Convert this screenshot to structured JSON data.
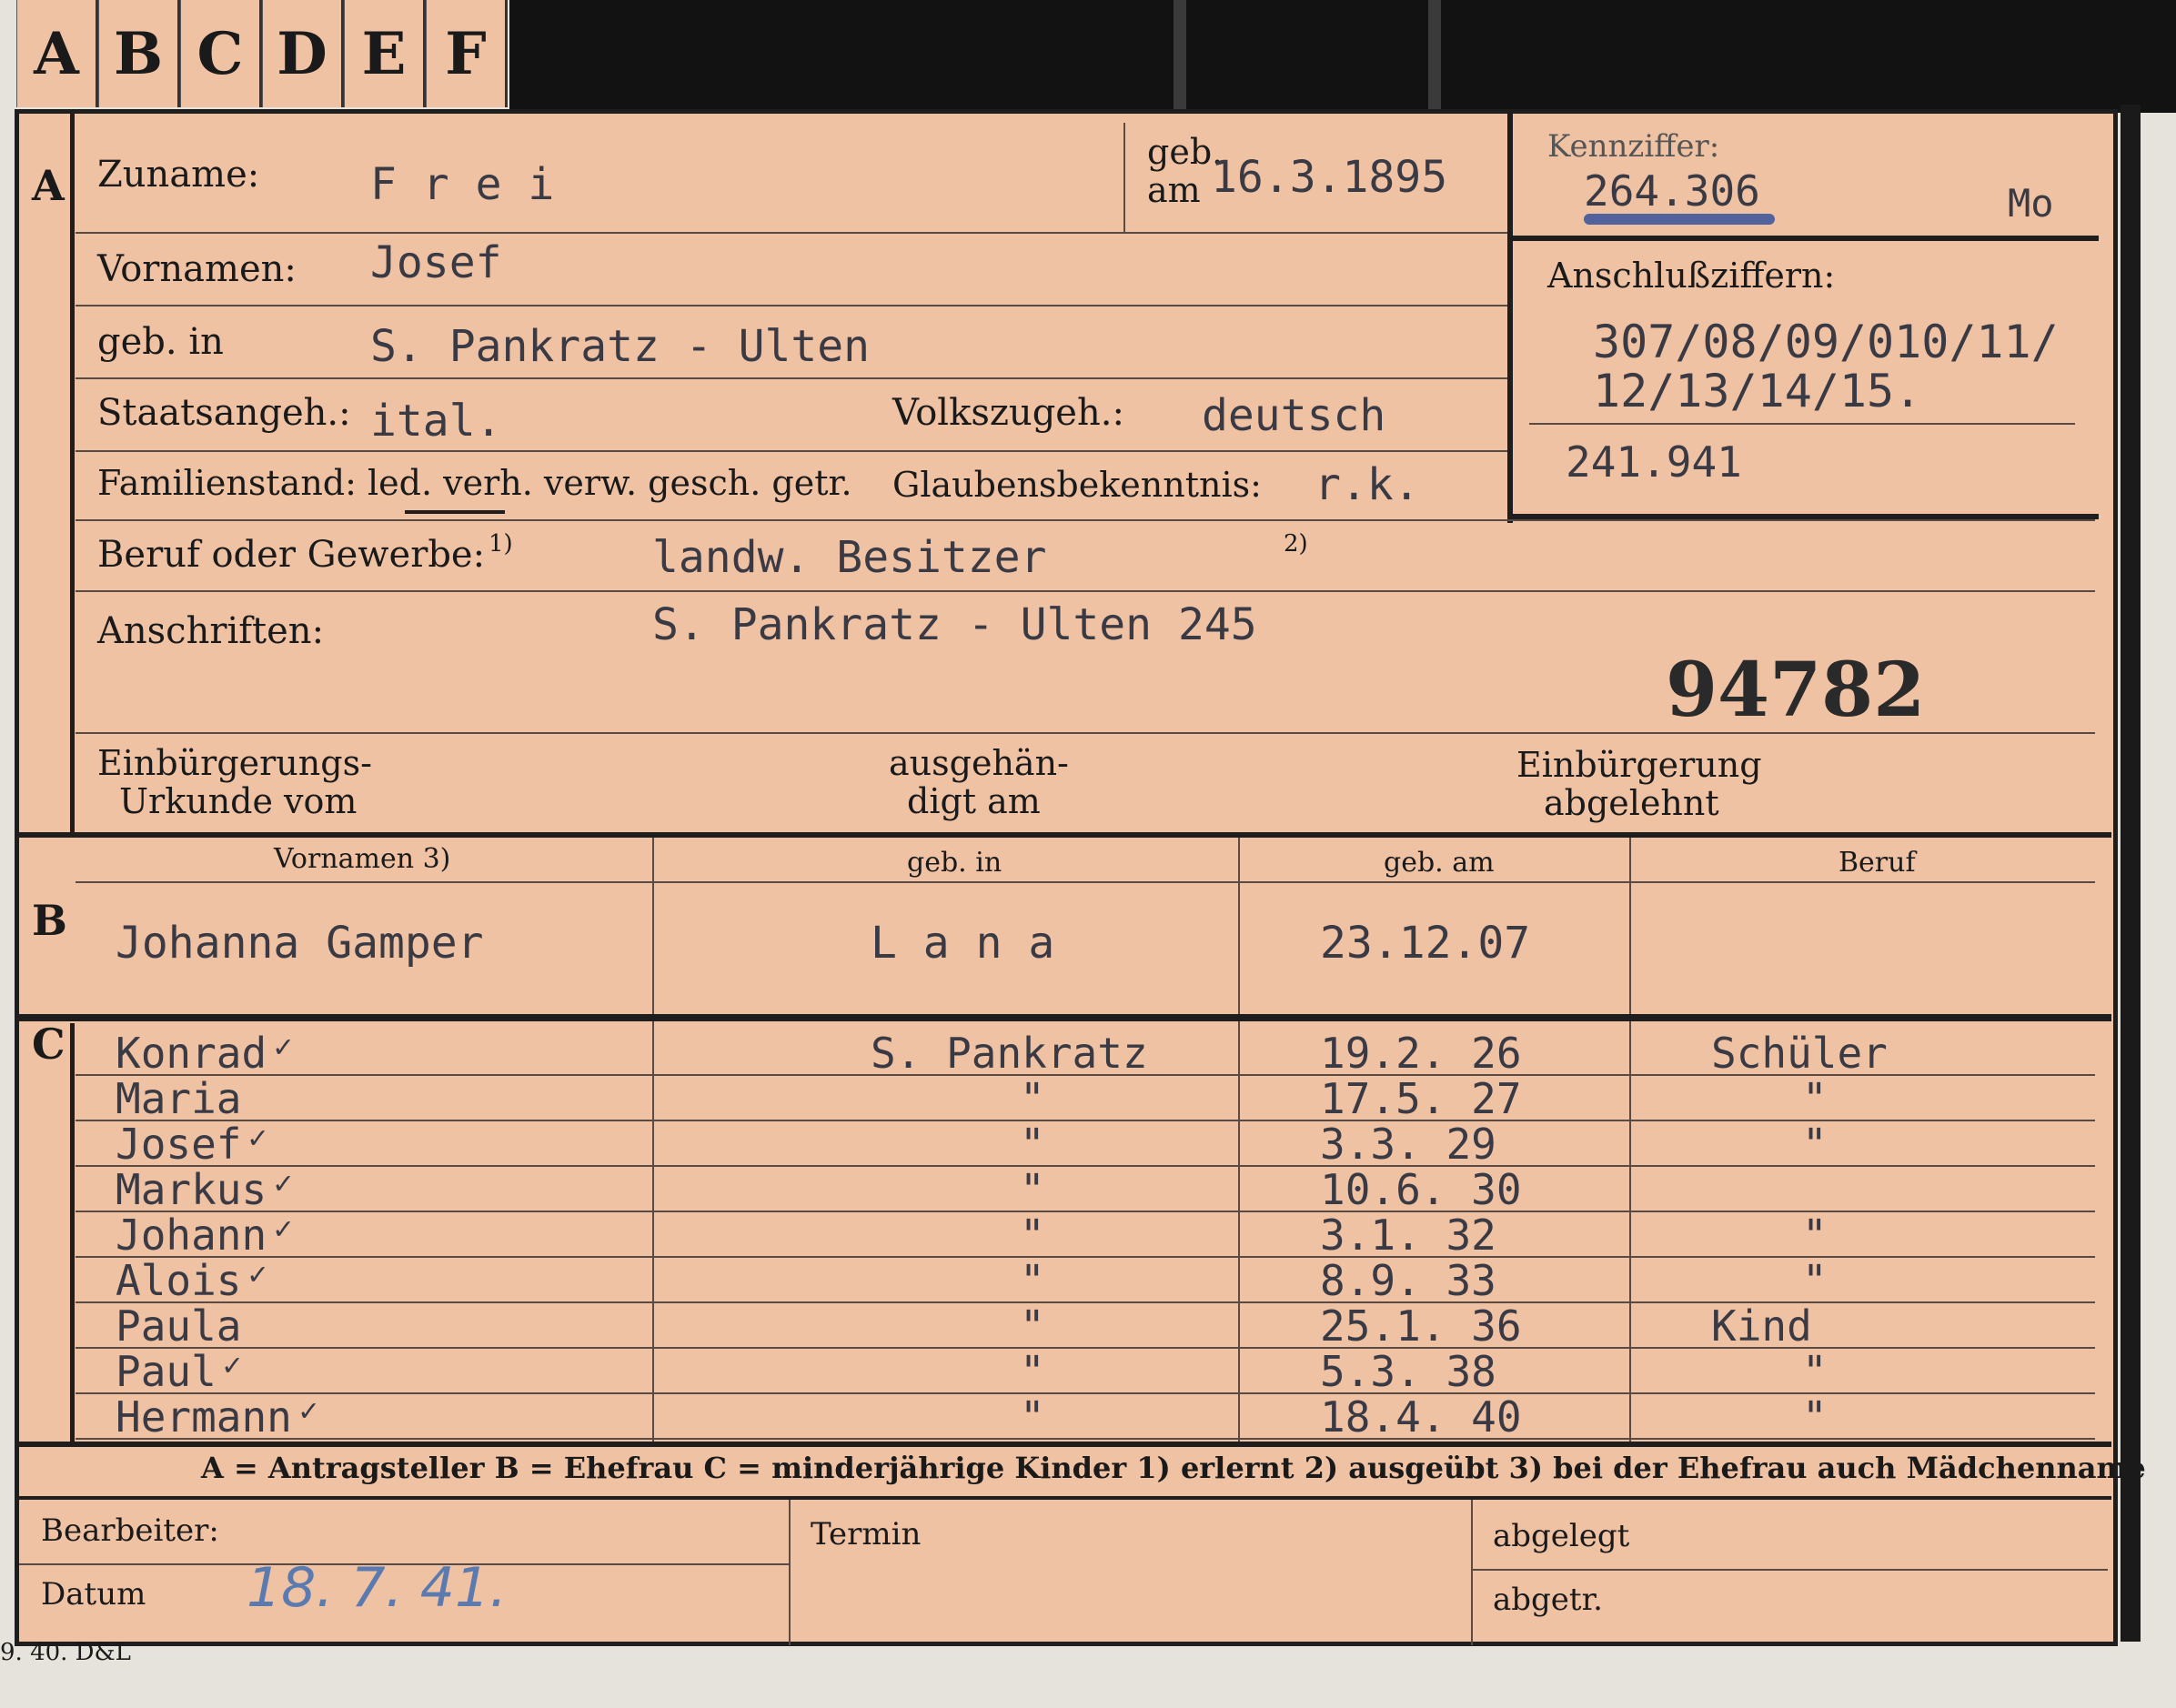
{
  "tabs": [
    "A",
    "B",
    "C",
    "D",
    "E",
    "F"
  ],
  "section_marks": {
    "a": "A",
    "b": "B",
    "c": "C"
  },
  "header": {
    "zuname_label": "Zuname:",
    "zuname_value": "F r e i",
    "geb_am_label_1": "geb.",
    "geb_am_label_2": "am",
    "geb_am_value": "16.3.1895",
    "kennziffer_label": "Kennziffer:",
    "kennziffer_value": "264.306",
    "kennziffer_suffix": "Mo",
    "vornamen_label": "Vornamen:",
    "vornamen_value": "Josef",
    "geb_in_label": "geb. in",
    "geb_in_value": "S. Pankratz - Ulten",
    "anschluss_label": "Anschlußziffern:",
    "anschluss_line1": "307/08/09/010/11/",
    "anschluss_line2": "12/13/14/15.",
    "anschluss_line3": "241.941",
    "staats_label": "Staatsangeh.:",
    "staats_value": "ital.",
    "volks_label": "Volkszugeh.:",
    "volks_value": "deutsch",
    "familien_label": "Familienstand: led. verh. verw. gesch. getr.",
    "glaubens_label": "Glaubensbekenntnis:",
    "glaubens_value": "r.k.",
    "beruf_label": "Beruf oder Gewerbe:",
    "beruf_note1": "1)",
    "beruf_value": "landw. Besitzer",
    "beruf_note2": "2)",
    "anschriften_label": "Anschriften:",
    "anschriften_value": "S. Pankratz - Ulten 245",
    "stamp_number": "94782",
    "einb_urkunde_1": "Einbürgerungs-",
    "einb_urkunde_2": "Urkunde vom",
    "ausgehaen_1": "ausgehän-",
    "ausgehaen_2": "digt am",
    "einb_abgelehnt_1": "Einbürgerung",
    "einb_abgelehnt_2": "abgelehnt"
  },
  "spouse": {
    "col_vornamen": "Vornamen 3)",
    "col_geb_in": "geb. in",
    "col_geb_am": "geb. am",
    "col_beruf": "Beruf",
    "name": "Johanna Gamper",
    "birthplace": "L a n a",
    "birthdate": "23.12.07",
    "occupation": ""
  },
  "children": [
    {
      "name": "Konrad",
      "check": "✓",
      "place": "S. Pankratz",
      "date": "19.2. 26",
      "job": "Schüler"
    },
    {
      "name": "Maria",
      "check": "",
      "place": "\"",
      "date": "17.5. 27",
      "job": "\""
    },
    {
      "name": "Josef",
      "check": "✓",
      "place": "\"",
      "date": "3.3. 29",
      "job": "\""
    },
    {
      "name": "Markus",
      "check": "✓",
      "place": "\"",
      "date": "10.6. 30",
      "job": ""
    },
    {
      "name": "Johann",
      "check": "✓",
      "place": "\"",
      "date": "3.1. 32",
      "job": "\""
    },
    {
      "name": "Alois",
      "check": "✓",
      "place": "\"",
      "date": "8.9. 33",
      "job": "\""
    },
    {
      "name": "Paula",
      "check": "",
      "place": "\"",
      "date": "25.1. 36",
      "job": "Kind"
    },
    {
      "name": "Paul",
      "check": "✓",
      "place": "\"",
      "date": "5.3. 38",
      "job": "\""
    },
    {
      "name": "Hermann",
      "check": "✓",
      "place": "\"",
      "date": "18.4. 40",
      "job": "\""
    }
  ],
  "legend": "A = Antragsteller   B = Ehefrau   C = minderjährige Kinder   1) erlernt   2) ausgeübt   3) bei der Ehefrau auch Mädchenname",
  "footer": {
    "bearbeiter_label": "Bearbeiter:",
    "datum_label": "Datum",
    "datum_value": "18. 7. 41.",
    "termin_label": "Termin",
    "abgelegt_label": "abgelegt",
    "abgetr_label": "abgetr."
  },
  "printer_mark": "9. 40. D&L"
}
